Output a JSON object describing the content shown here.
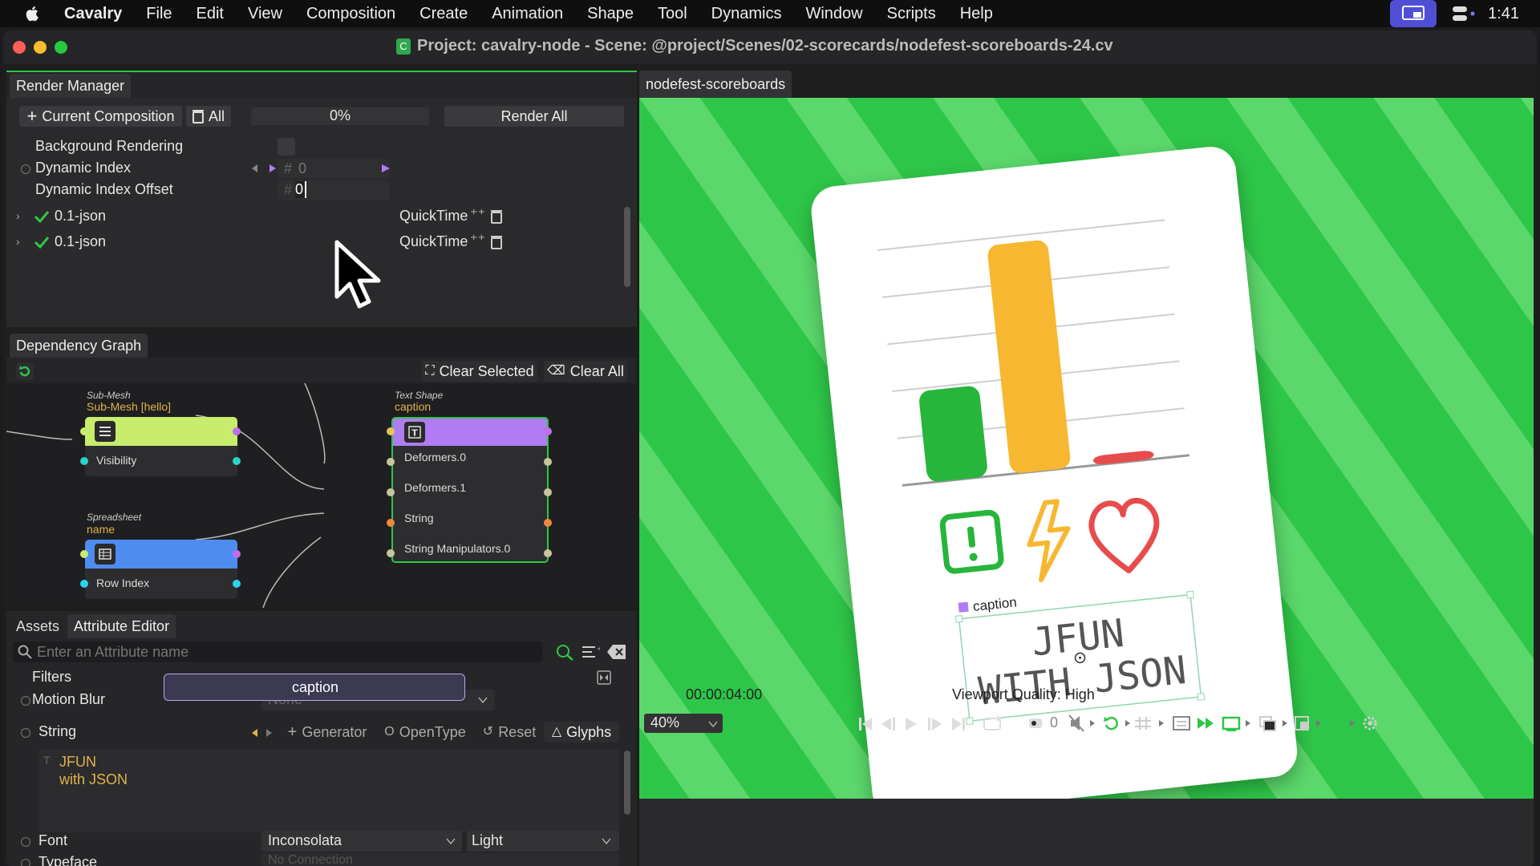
{
  "menubar": {
    "app": "Cavalry",
    "items": [
      "File",
      "Edit",
      "View",
      "Composition",
      "Create",
      "Animation",
      "Shape",
      "Tool",
      "Dynamics",
      "Window",
      "Scripts",
      "Help"
    ],
    "time": "1:41"
  },
  "window": {
    "title": "Project: cavalry-node - Scene: @project/Scenes/02-scorecards/nodefest-scoreboards-24.cv"
  },
  "render_manager": {
    "tab": "Render Manager",
    "current_composition": "Current Composition",
    "all": "All",
    "progress": "0%",
    "render_all": "Render All",
    "background_rendering": "Background Rendering",
    "dynamic_index": "Dynamic Index",
    "dynamic_index_value": "0",
    "dynamic_index_offset": "Dynamic Index Offset",
    "dynamic_index_offset_value": "0",
    "hash": "#",
    "jobs": [
      {
        "name": "0.1-json",
        "format": "QuickTime"
      },
      {
        "name": "0.1-json",
        "format": "QuickTime"
      }
    ]
  },
  "dependency_graph": {
    "tab": "Dependency Graph",
    "clear_selected": "Clear Selected",
    "clear_all": "Clear All",
    "nodes": {
      "submesh": {
        "type": "Sub-Mesh",
        "name": "Sub-Mesh [hello]",
        "ports": [
          "Visibility"
        ]
      },
      "spreadsheet": {
        "type": "Spreadsheet",
        "name": "name",
        "ports": [
          "Row Index"
        ]
      },
      "text_shape": {
        "type": "Text Shape",
        "name": "caption",
        "ports": [
          "Deformers.0",
          "Deformers.1",
          "String",
          "String Manipulators.0"
        ]
      }
    }
  },
  "attribute_editor": {
    "tabs": [
      "Assets",
      "Attribute Editor"
    ],
    "search_placeholder": "Enter an Attribute name",
    "filters": "Filters",
    "caption_popup": "caption",
    "motion_blur": "Motion Blur",
    "motion_blur_value": "None",
    "string": "String",
    "generator": "Generator",
    "opentype": "OpenType",
    "reset": "Reset",
    "glyphs": "Glyphs",
    "string_value_line1": "JFUN",
    "string_value_line2": "with JSON",
    "font": "Font",
    "font_value": "Inconsolata",
    "font_style": "Light",
    "typeface": "Typeface",
    "typeface_value": "No Connection"
  },
  "viewport": {
    "tab": "nodefest-scoreboards",
    "timecode": "00:00:04:00",
    "quality": "Viewport Quality: High",
    "zoom": "40%",
    "frame_field": "0",
    "caption_label": "caption",
    "card_text_line1": "JFUN",
    "card_text_line2": "WITH JSON"
  },
  "chart_data": {
    "type": "bar",
    "categories": [
      "green",
      "yellow",
      "red"
    ],
    "values": [
      40,
      100,
      4
    ],
    "ylim": [
      0,
      110
    ]
  },
  "colors": {
    "accent_purple": "#b07cf2",
    "submesh_green": "#c8ec6c",
    "spreadsheet_blue": "#4e8cf0",
    "viewport_green": "#2ec648",
    "bar_green": "#27b53c",
    "bar_yellow": "#f7b730",
    "bar_red": "#e74c4c"
  }
}
